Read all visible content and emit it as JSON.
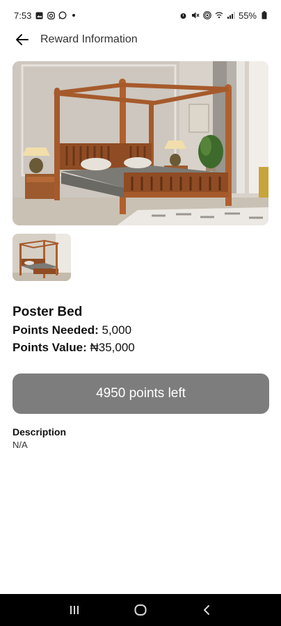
{
  "status_bar": {
    "time": "7:53",
    "battery": "55%",
    "left_icons": [
      "gallery-icon",
      "instagram-icon",
      "whatsapp-icon"
    ],
    "right_icons": [
      "alarm-icon",
      "mute-icon",
      "hotspot-icon",
      "wifi-icon",
      "signal-icon",
      "battery-icon"
    ]
  },
  "header": {
    "title": "Reward Information",
    "back_icon": "arrow-left-icon"
  },
  "product": {
    "name": "Poster Bed",
    "points_needed_label": "Points Needed:",
    "points_needed_value": "5,000",
    "points_value_label": "Points Value:",
    "points_value_value": "₦35,000",
    "images": [
      "poster-bed-main",
      "poster-bed-thumb"
    ]
  },
  "action": {
    "points_left_label": "4950 points left"
  },
  "description": {
    "label": "Description",
    "value": "N/A"
  },
  "nav_bar": {
    "buttons": [
      "recent-apps-icon",
      "home-icon",
      "back-icon"
    ]
  },
  "colors": {
    "button_bg": "#7d7d7d",
    "nav_bg": "#000000"
  }
}
